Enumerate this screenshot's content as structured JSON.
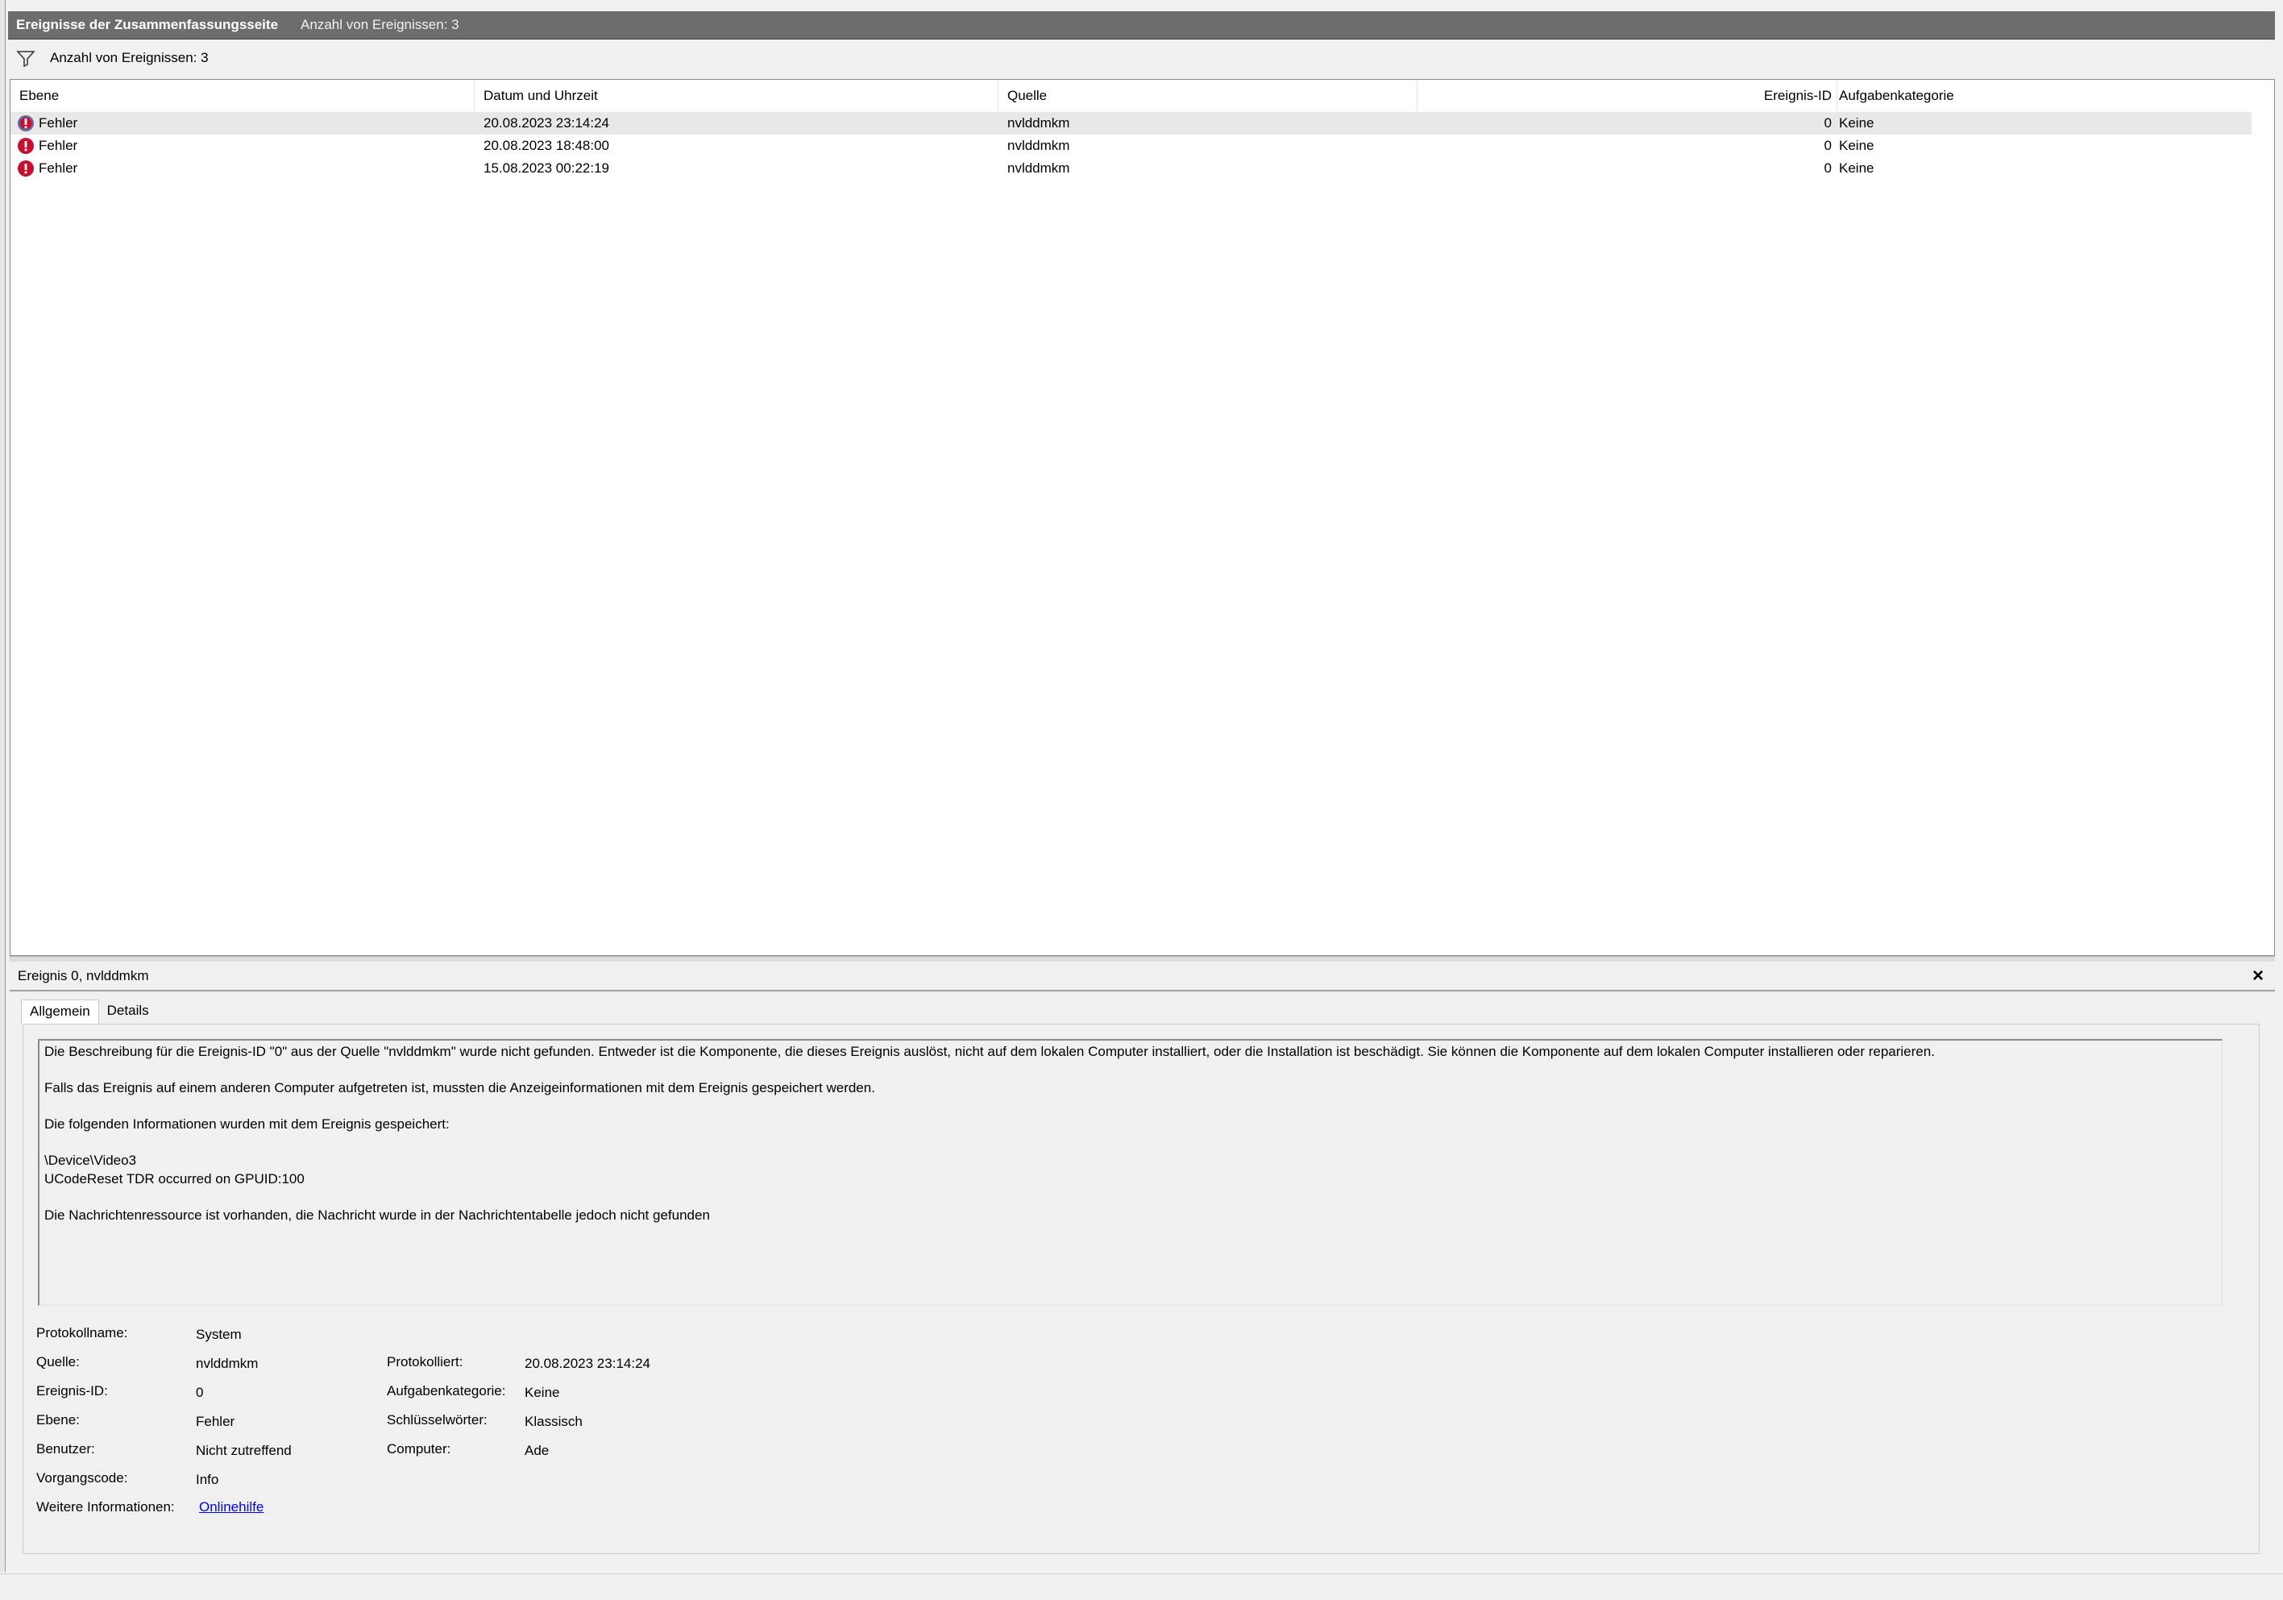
{
  "title_bar": {
    "title": "Ereignisse der Zusammenfassungsseite",
    "count": "Anzahl von Ereignissen: 3"
  },
  "filter_bar": {
    "icon": "filter-icon",
    "label": "Anzahl von Ereignissen: 3"
  },
  "event_list": {
    "columns": {
      "level": "Ebene",
      "datetime": "Datum und Uhrzeit",
      "source": "Quelle",
      "event_id": "Ereignis-ID",
      "task_category": "Aufgabenkategorie"
    },
    "rows": [
      {
        "level": "Fehler",
        "datetime": "20.08.2023 23:14:24",
        "source": "nvlddmkm",
        "event_id": "0",
        "task_category": "Keine",
        "icon": "error-icon",
        "selected": true
      },
      {
        "level": "Fehler",
        "datetime": "20.08.2023 18:48:00",
        "source": "nvlddmkm",
        "event_id": "0",
        "task_category": "Keine",
        "icon": "error-icon",
        "selected": false
      },
      {
        "level": "Fehler",
        "datetime": "15.08.2023 00:22:19",
        "source": "nvlddmkm",
        "event_id": "0",
        "task_category": "Keine",
        "icon": "error-icon",
        "selected": false
      }
    ]
  },
  "detail": {
    "title": "Ereignis 0, nvlddmkm",
    "close_label": "×",
    "tabs": [
      "Allgemein",
      "Details"
    ],
    "active_tab": "Allgemein",
    "description": [
      "Die Beschreibung für die Ereignis-ID \"0\" aus der Quelle \"nvlddmkm\" wurde nicht gefunden. Entweder ist die Komponente, die dieses Ereignis auslöst, nicht auf dem lokalen Computer installiert, oder die Installation ist beschädigt. Sie können die Komponente auf dem lokalen Computer installieren oder reparieren.",
      "Falls das Ereignis auf einem anderen Computer aufgetreten ist, mussten die Anzeigeinformationen mit dem Ereignis gespeichert werden.",
      "Die folgenden Informationen wurden mit dem Ereignis gespeichert:",
      "\\Device\\Video3",
      "UCodeReset TDR occurred on GPUID:100",
      "Die Nachrichtenressource ist vorhanden, die Nachricht wurde in der Nachrichtentabelle jedoch nicht gefunden"
    ],
    "fields": {
      "log_name_label": "Protokollname:",
      "log_name": "System",
      "source_label": "Quelle:",
      "source": "nvlddmkm",
      "logged_label": "Protokolliert:",
      "logged": "20.08.2023 23:14:24",
      "event_id_label": "Ereignis-ID:",
      "event_id": "0",
      "task_category_label": "Aufgabenkategorie:",
      "task_category": "Keine",
      "level_label": "Ebene:",
      "level": "Fehler",
      "keywords_label": "Schlüsselwörter:",
      "keywords": "Klassisch",
      "user_label": "Benutzer:",
      "user": "Nicht zutreffend",
      "computer_label": "Computer:",
      "computer": "Ade",
      "opcode_label": "Vorgangscode:",
      "opcode": "Info",
      "more_info_label": "Weitere Informationen:",
      "more_info_link": "Onlinehilfe"
    }
  },
  "colors": {
    "titlebar_bg": "#6d6d6d",
    "error_red": "#c8102e",
    "link_blue": "#0000ee",
    "selected_row": "#e8e8e8"
  }
}
